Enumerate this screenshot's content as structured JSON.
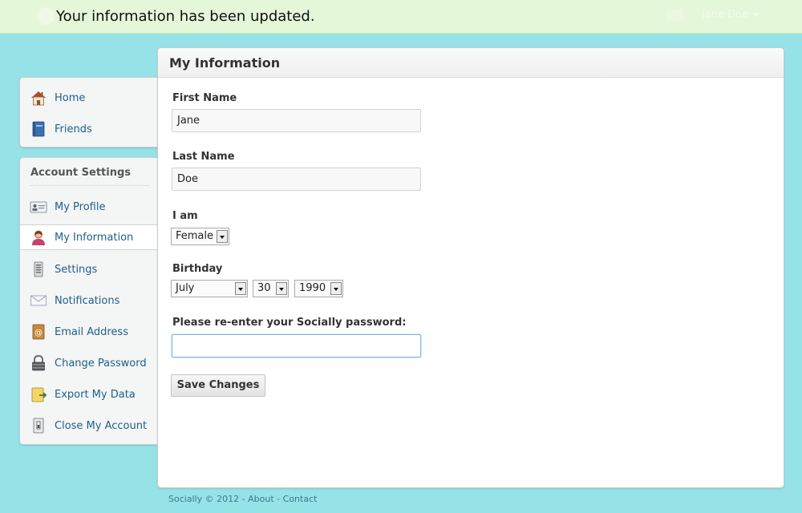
{
  "topbar": {
    "notice": "Your information has been updated.",
    "user_name": "Jane Doe"
  },
  "sidebar": {
    "nav_items": [
      {
        "label": "Home",
        "icon": "house-icon"
      },
      {
        "label": "Friends",
        "icon": "address-book-icon"
      }
    ],
    "account_heading": "Account Settings",
    "account_items": [
      {
        "label": "My Profile",
        "icon": "id-card-icon"
      },
      {
        "label": "My Information",
        "icon": "user-icon",
        "active": true
      },
      {
        "label": "Settings",
        "icon": "settings-device-icon"
      },
      {
        "label": "Notifications",
        "icon": "envelope-icon"
      },
      {
        "label": "Email Address",
        "icon": "email-book-icon"
      },
      {
        "label": "Change Password",
        "icon": "padlock-icon"
      },
      {
        "label": "Export My Data",
        "icon": "export-icon"
      },
      {
        "label": "Close My Account",
        "icon": "switch-icon"
      }
    ]
  },
  "form": {
    "title": "My Information",
    "first_name_label": "First Name",
    "first_name_value": "Jane",
    "last_name_label": "Last Name",
    "last_name_value": "Doe",
    "gender_label": "I am",
    "gender_value": "Female",
    "birthday_label": "Birthday",
    "birth_month": "July",
    "birth_day": "30",
    "birth_year": "1990",
    "password_label": "Please re-enter your Socially password:",
    "password_value": "",
    "save_label": "Save Changes"
  },
  "footer": {
    "copyright": "Socially © 2012",
    "sep": " - ",
    "about": "About",
    "contact": "Contact"
  },
  "colors": {
    "background": "#95e3e7",
    "notice_bg": "#e4f7d8",
    "link": "#1f5f8c"
  }
}
